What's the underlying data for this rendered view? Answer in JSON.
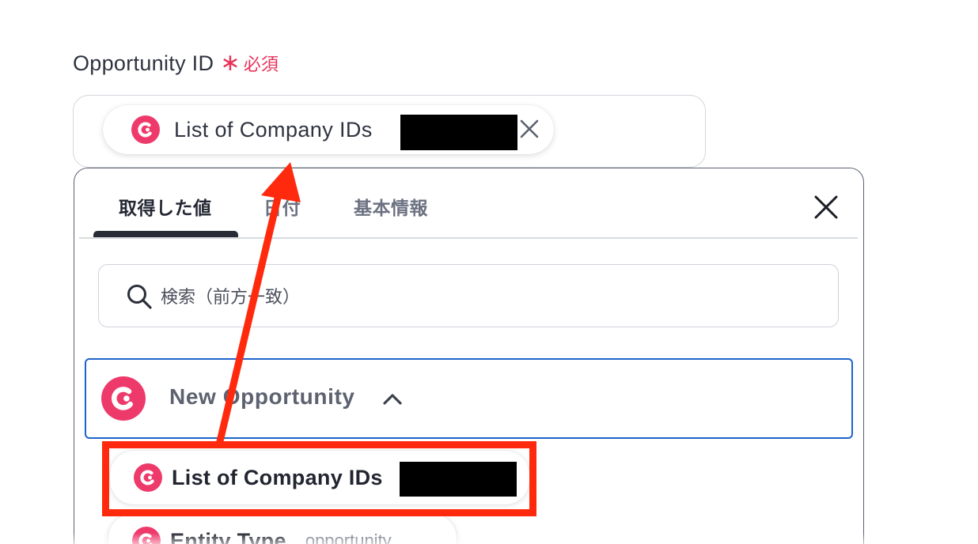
{
  "field": {
    "label": "Opportunity ID",
    "required_mark": "∗",
    "required_text": "必須",
    "selected_chip": {
      "label": "List of Company IDs",
      "icon": "brand-logo-icon",
      "remove_icon": "close-icon"
    }
  },
  "panel": {
    "tabs": [
      {
        "label": "取得した値",
        "active": true
      },
      {
        "label": "日付",
        "active": false
      },
      {
        "label": "基本情報",
        "active": false
      }
    ],
    "close_icon": "close-icon",
    "search": {
      "placeholder": "検索（前方一致）",
      "value": "",
      "icon": "search-icon"
    },
    "section": {
      "title": "New Opportunity",
      "icon": "brand-logo-icon",
      "toggle_icon": "chevron-up-icon",
      "expanded": true,
      "items": [
        {
          "label": "List of Company IDs",
          "value": ""
        },
        {
          "label": "Entity Type",
          "value": "opportunity"
        }
      ]
    }
  },
  "annotation": {
    "highlight_color": "#ff2a0e",
    "arrow_color": "#ff2a0e"
  },
  "colors": {
    "brand_pink": "#ee3a6b",
    "required_red": "#e8325a",
    "focus_blue": "#1f63c9"
  }
}
